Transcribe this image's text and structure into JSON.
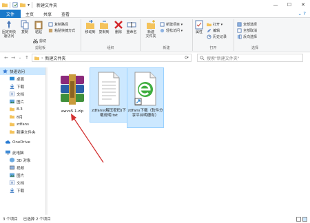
{
  "window": {
    "title": "新建文件夹",
    "min_label": "—",
    "max_label": "☐",
    "close_label": "✕"
  },
  "tabs": [
    {
      "label": "文件"
    },
    {
      "label": "主页"
    },
    {
      "label": "共享"
    },
    {
      "label": "查看"
    }
  ],
  "ribbon": {
    "clipboard": {
      "group_label": "剪贴板",
      "pin_label": "固定到快\n速访问",
      "copy_label": "复制",
      "paste_label": "粘贴",
      "copy_path_label": "复制路径",
      "paste_shortcut_label": "粘贴快捷方式",
      "cut_label": "剪切"
    },
    "organize": {
      "group_label": "组织",
      "move_to_label": "移动到",
      "copy_to_label": "复制到",
      "delete_label": "删除",
      "rename_label": "重命名"
    },
    "new": {
      "group_label": "新建",
      "new_folder_label": "新建\n文件夹",
      "new_item_label": "新建项目 ▾",
      "easy_access_label": "轻松访问 ▾"
    },
    "open": {
      "group_label": "打开",
      "properties_label": "属性",
      "open_label": "打开 ▾",
      "edit_label": "编辑",
      "history_label": "历史记录"
    },
    "select": {
      "group_label": "选择",
      "select_all_label": "全部选择",
      "select_none_label": "全部取消",
      "invert_label": "反向选择"
    }
  },
  "address": {
    "path": "新建文件夹",
    "search_placeholder": "搜索\"新建文件夹\""
  },
  "nav": {
    "items": [
      {
        "label": "快速访问"
      },
      {
        "label": "桌面"
      },
      {
        "label": "下载"
      },
      {
        "label": "文档"
      },
      {
        "label": "图片"
      },
      {
        "label": "8.3"
      },
      {
        "label": "8月"
      },
      {
        "label": "zdfans"
      },
      {
        "label": "新建文件夹"
      },
      {
        "label": "OneDrive"
      },
      {
        "label": "此电脑"
      },
      {
        "label": "3D 对象"
      },
      {
        "label": "视频"
      },
      {
        "label": "图片"
      },
      {
        "label": "文档"
      },
      {
        "label": "下载"
      }
    ]
  },
  "files": [
    {
      "name": "awvs5.1.zip"
    },
    {
      "name": "zdfans(解压密码)下载说明.txt"
    },
    {
      "name": "zdfans下载（软件分享平台明德有）"
    }
  ],
  "status": {
    "count": "3 个项目",
    "selected": "已选择 2 个项目"
  },
  "colors": {
    "accent": "#1979ca",
    "selection": "#cce8ff",
    "arrow": "#d32f2f"
  }
}
